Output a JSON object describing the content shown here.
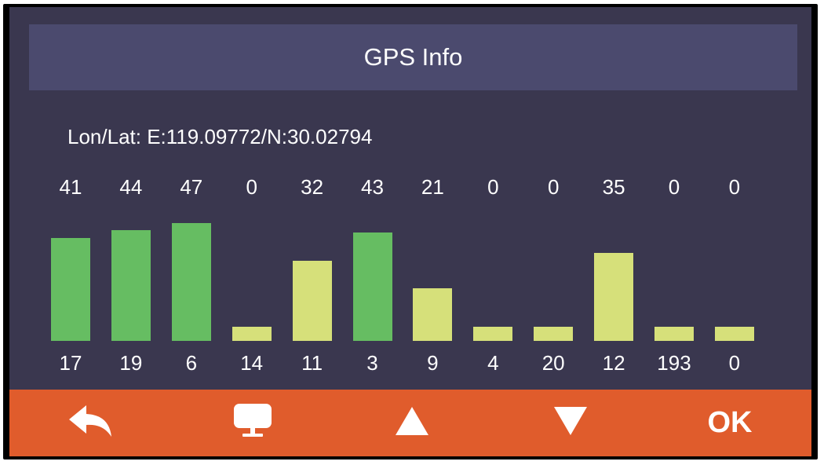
{
  "header": {
    "title": "GPS Info"
  },
  "position": {
    "lon_lat_label": "Lon/Lat:",
    "lon": "E:119.09772",
    "lat": "N:30.02794"
  },
  "satellites": [
    {
      "snr": "41",
      "prn": "17",
      "status": "used"
    },
    {
      "snr": "44",
      "prn": "19",
      "status": "used"
    },
    {
      "snr": "47",
      "prn": "6",
      "status": "used"
    },
    {
      "snr": "0",
      "prn": "14",
      "status": "visible"
    },
    {
      "snr": "32",
      "prn": "11",
      "status": "visible"
    },
    {
      "snr": "43",
      "prn": "3",
      "status": "used"
    },
    {
      "snr": "21",
      "prn": "9",
      "status": "visible"
    },
    {
      "snr": "0",
      "prn": "4",
      "status": "visible"
    },
    {
      "snr": "0",
      "prn": "20",
      "status": "visible"
    },
    {
      "snr": "35",
      "prn": "12",
      "status": "visible"
    },
    {
      "snr": "0",
      "prn": "193",
      "status": "visible"
    },
    {
      "snr": "0",
      "prn": "0",
      "status": "visible"
    }
  ],
  "colors": {
    "background": "#3a374f",
    "title_bar": "#4b4a6e",
    "used_bar": "#66bd62",
    "visible_bar": "#d6e07a",
    "bottom_bar": "#e05c2c"
  },
  "toolbar": {
    "back_icon": "back-arrow-icon",
    "monitor_icon": "monitor-icon",
    "up_icon": "triangle-up-icon",
    "down_icon": "triangle-down-icon",
    "ok_label": "OK"
  }
}
